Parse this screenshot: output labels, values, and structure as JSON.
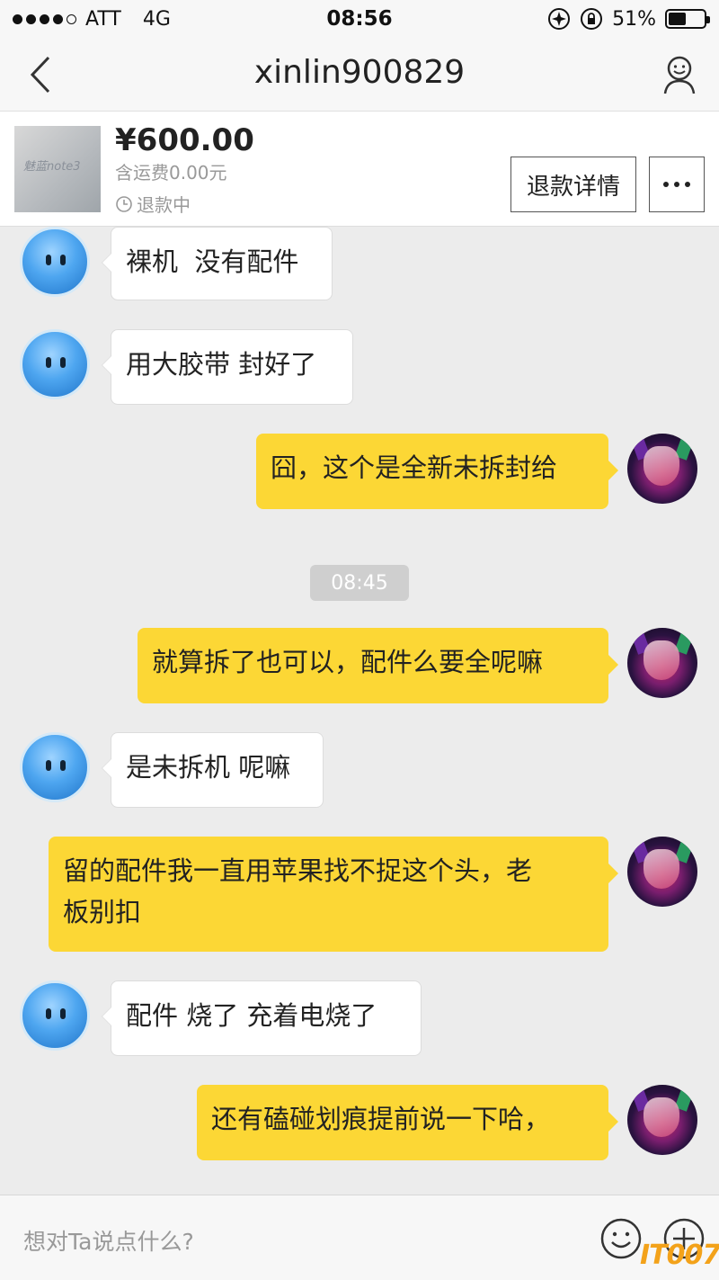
{
  "status_bar": {
    "carrier": "ATT",
    "network": "4G",
    "time": "08:56",
    "battery": "51%",
    "battery_level": 0.51
  },
  "nav": {
    "title": "xinlin900829"
  },
  "product": {
    "thumb_label": "魅蓝note3",
    "price": "¥600.00",
    "shipping": "含运费0.00元",
    "status": "退款中",
    "refund_button": "退款详情"
  },
  "messages": [
    {
      "from": "other",
      "text": "裸机  没有配件"
    },
    {
      "from": "other",
      "text": "用大胶带 封好了"
    },
    {
      "from": "me",
      "text": "囧，这个是全新未拆封给"
    },
    {
      "from": "me",
      "text": "就算拆了也可以，配件么要全呢嘛"
    },
    {
      "from": "other",
      "text": "是未拆机 呢嘛"
    },
    {
      "from": "me",
      "text": "留的配件我一直用苹果找不捉这个头，老\n板别扣"
    },
    {
      "from": "other",
      "text": "配件 烧了 充着电烧了"
    },
    {
      "from": "me",
      "text": "还有磕碰划痕提前说一下哈，"
    }
  ],
  "timestamp": "08:45",
  "input": {
    "placeholder": "想对Ta说点什么?"
  },
  "watermark": "IT007",
  "colors": {
    "outgoing_bubble": "#fcd735",
    "incoming_bubble": "#ffffff",
    "background": "#ececec"
  }
}
